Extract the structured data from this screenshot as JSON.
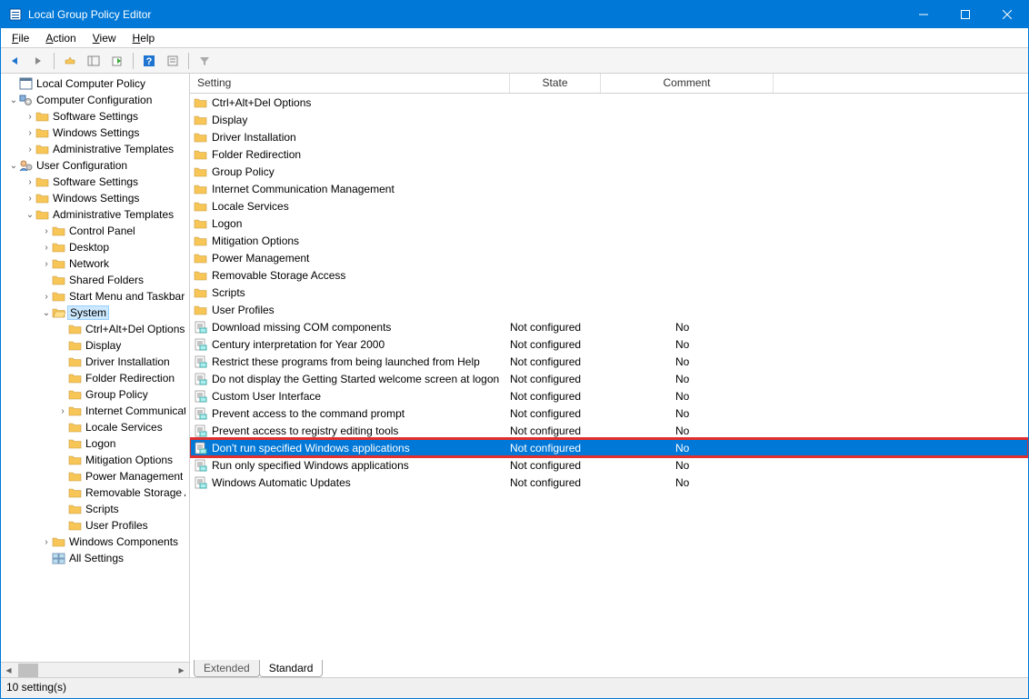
{
  "title": "Local Group Policy Editor",
  "menus": {
    "file": "File",
    "action": "Action",
    "view": "View",
    "help": "Help"
  },
  "tree": [
    {
      "depth": 0,
      "expander": "",
      "icon": "console",
      "label": "Local Computer Policy"
    },
    {
      "depth": 0,
      "expander": "v",
      "icon": "gear",
      "label": "Computer Configuration"
    },
    {
      "depth": 1,
      "expander": ">",
      "icon": "folder",
      "label": "Software Settings"
    },
    {
      "depth": 1,
      "expander": ">",
      "icon": "folder",
      "label": "Windows Settings"
    },
    {
      "depth": 1,
      "expander": ">",
      "icon": "folder",
      "label": "Administrative Templates"
    },
    {
      "depth": 0,
      "expander": "v",
      "icon": "user",
      "label": "User Configuration"
    },
    {
      "depth": 1,
      "expander": ">",
      "icon": "folder",
      "label": "Software Settings"
    },
    {
      "depth": 1,
      "expander": ">",
      "icon": "folder",
      "label": "Windows Settings"
    },
    {
      "depth": 1,
      "expander": "v",
      "icon": "folder",
      "label": "Administrative Templates"
    },
    {
      "depth": 2,
      "expander": ">",
      "icon": "folder",
      "label": "Control Panel"
    },
    {
      "depth": 2,
      "expander": ">",
      "icon": "folder",
      "label": "Desktop"
    },
    {
      "depth": 2,
      "expander": ">",
      "icon": "folder",
      "label": "Network"
    },
    {
      "depth": 2,
      "expander": "",
      "icon": "folder",
      "label": "Shared Folders"
    },
    {
      "depth": 2,
      "expander": ">",
      "icon": "folder",
      "label": "Start Menu and Taskbar"
    },
    {
      "depth": 2,
      "expander": "v",
      "icon": "folder-open",
      "label": "System",
      "active": true
    },
    {
      "depth": 3,
      "expander": "",
      "icon": "folder",
      "label": "Ctrl+Alt+Del Options"
    },
    {
      "depth": 3,
      "expander": "",
      "icon": "folder",
      "label": "Display"
    },
    {
      "depth": 3,
      "expander": "",
      "icon": "folder",
      "label": "Driver Installation"
    },
    {
      "depth": 3,
      "expander": "",
      "icon": "folder",
      "label": "Folder Redirection"
    },
    {
      "depth": 3,
      "expander": "",
      "icon": "folder",
      "label": "Group Policy"
    },
    {
      "depth": 3,
      "expander": ">",
      "icon": "folder",
      "label": "Internet Communication Management"
    },
    {
      "depth": 3,
      "expander": "",
      "icon": "folder",
      "label": "Locale Services"
    },
    {
      "depth": 3,
      "expander": "",
      "icon": "folder",
      "label": "Logon"
    },
    {
      "depth": 3,
      "expander": "",
      "icon": "folder",
      "label": "Mitigation Options"
    },
    {
      "depth": 3,
      "expander": "",
      "icon": "folder",
      "label": "Power Management"
    },
    {
      "depth": 3,
      "expander": "",
      "icon": "folder",
      "label": "Removable Storage Access"
    },
    {
      "depth": 3,
      "expander": "",
      "icon": "folder",
      "label": "Scripts"
    },
    {
      "depth": 3,
      "expander": "",
      "icon": "folder",
      "label": "User Profiles"
    },
    {
      "depth": 2,
      "expander": ">",
      "icon": "folder",
      "label": "Windows Components"
    },
    {
      "depth": 2,
      "expander": "",
      "icon": "allsettings",
      "label": "All Settings"
    }
  ],
  "columns": {
    "setting": "Setting",
    "state": "State",
    "comment": "Comment"
  },
  "list": [
    {
      "icon": "folder",
      "setting": "Ctrl+Alt+Del Options",
      "state": "",
      "comment": ""
    },
    {
      "icon": "folder",
      "setting": "Display",
      "state": "",
      "comment": ""
    },
    {
      "icon": "folder",
      "setting": "Driver Installation",
      "state": "",
      "comment": ""
    },
    {
      "icon": "folder",
      "setting": "Folder Redirection",
      "state": "",
      "comment": ""
    },
    {
      "icon": "folder",
      "setting": "Group Policy",
      "state": "",
      "comment": ""
    },
    {
      "icon": "folder",
      "setting": "Internet Communication Management",
      "state": "",
      "comment": ""
    },
    {
      "icon": "folder",
      "setting": "Locale Services",
      "state": "",
      "comment": ""
    },
    {
      "icon": "folder",
      "setting": "Logon",
      "state": "",
      "comment": ""
    },
    {
      "icon": "folder",
      "setting": "Mitigation Options",
      "state": "",
      "comment": ""
    },
    {
      "icon": "folder",
      "setting": "Power Management",
      "state": "",
      "comment": ""
    },
    {
      "icon": "folder",
      "setting": "Removable Storage Access",
      "state": "",
      "comment": ""
    },
    {
      "icon": "folder",
      "setting": "Scripts",
      "state": "",
      "comment": ""
    },
    {
      "icon": "folder",
      "setting": "User Profiles",
      "state": "",
      "comment": ""
    },
    {
      "icon": "policy",
      "setting": "Download missing COM components",
      "state": "Not configured",
      "comment": "No"
    },
    {
      "icon": "policy",
      "setting": "Century interpretation for Year 2000",
      "state": "Not configured",
      "comment": "No"
    },
    {
      "icon": "policy",
      "setting": "Restrict these programs from being launched from Help",
      "state": "Not configured",
      "comment": "No"
    },
    {
      "icon": "policy",
      "setting": "Do not display the Getting Started welcome screen at logon",
      "state": "Not configured",
      "comment": "No"
    },
    {
      "icon": "policy",
      "setting": "Custom User Interface",
      "state": "Not configured",
      "comment": "No"
    },
    {
      "icon": "policy",
      "setting": "Prevent access to the command prompt",
      "state": "Not configured",
      "comment": "No"
    },
    {
      "icon": "policy",
      "setting": "Prevent access to registry editing tools",
      "state": "Not configured",
      "comment": "No"
    },
    {
      "icon": "policy",
      "setting": "Don't run specified Windows applications",
      "state": "Not configured",
      "comment": "No",
      "selected": true,
      "highlight": true
    },
    {
      "icon": "policy",
      "setting": "Run only specified Windows applications",
      "state": "Not configured",
      "comment": "No"
    },
    {
      "icon": "policy",
      "setting": "Windows Automatic Updates",
      "state": "Not configured",
      "comment": "No"
    }
  ],
  "tabs": {
    "extended": "Extended",
    "standard": "Standard"
  },
  "status": "10 setting(s)"
}
